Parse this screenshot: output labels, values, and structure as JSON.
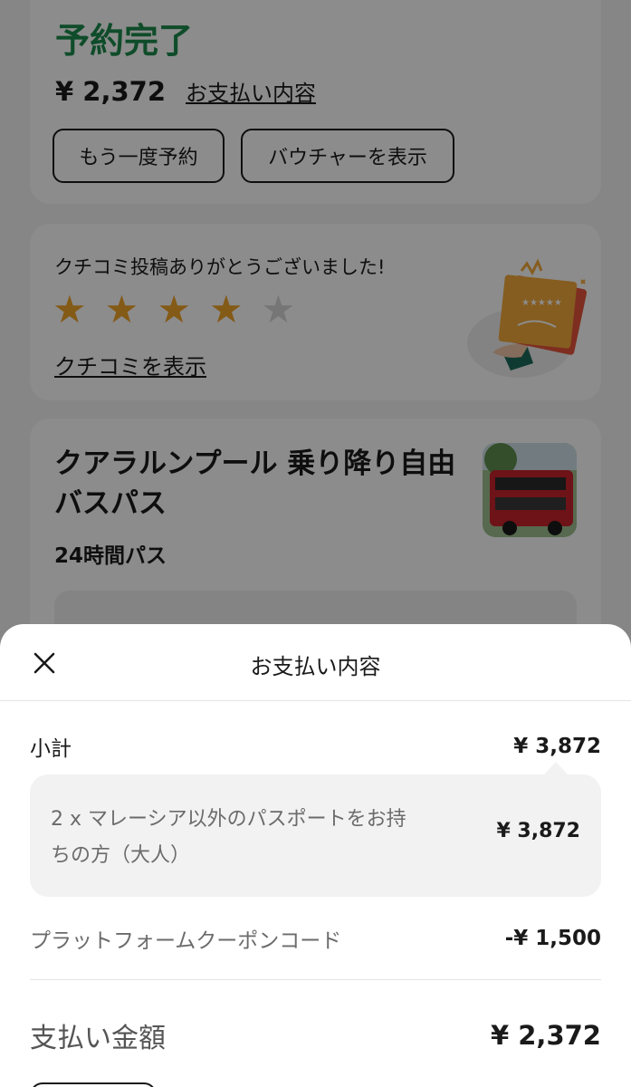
{
  "status": {
    "title": "予約完了",
    "price": "¥ 2,372",
    "payment_link": "お支払い内容",
    "rebook_button": "もう一度予約",
    "voucher_button": "バウチャーを表示"
  },
  "review": {
    "message": "クチコミ投稿ありがとうございました!",
    "rating": 4,
    "max_rating": 5,
    "link": "クチコミを表示"
  },
  "product": {
    "title": "クアラルンプール 乗り降り自由バスパス",
    "subtitle": "24時間パス"
  },
  "sheet": {
    "title": "お支払い内容",
    "subtotal_label": "小計",
    "subtotal_amount": "¥ 3,872",
    "detail_text": "2 x マレーシア以外のパスポートをお持ちの方（大人）",
    "detail_amount": "¥ 3,872",
    "coupon_label": "プラットフォームクーポンコード",
    "coupon_amount": "-¥ 1,500",
    "total_label": "支払い金額",
    "total_amount": "¥ 2,372"
  },
  "colors": {
    "status_green": "#1d8a4e",
    "star_gold": "#f0a52a"
  }
}
